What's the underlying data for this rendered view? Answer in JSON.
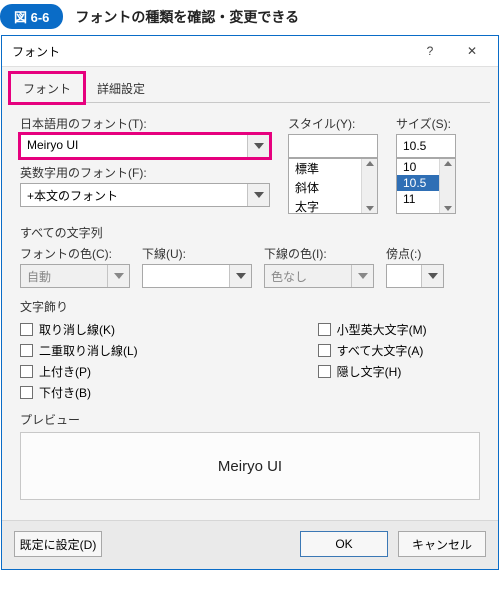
{
  "figure": {
    "badge": "図 6-6",
    "caption": "フォントの種類を確認・変更できる"
  },
  "dialog": {
    "title": "フォント",
    "tabs": {
      "font": "フォント",
      "advanced": "詳細設定"
    }
  },
  "labels": {
    "jpFont": "日本語用のフォント(T):",
    "latinFont": "英数字用のフォント(F):",
    "style": "スタイル(Y):",
    "size": "サイズ(S):",
    "allText": "すべての文字列",
    "fontColor": "フォントの色(C):",
    "underline": "下線(U):",
    "underlineColor": "下線の色(I):",
    "emphasis": "傍点(:)",
    "decor": "文字飾り",
    "preview": "プレビュー"
  },
  "values": {
    "jpFont": "Meiryo UI",
    "latinFont": "+本文のフォント",
    "styleSelected": "",
    "styleOptions": [
      "標準",
      "斜体",
      "太字"
    ],
    "sizeValue": "10.5",
    "sizeOptions": [
      "10",
      "10.5",
      "11"
    ],
    "sizeSelected": "10.5",
    "fontColor": "自動",
    "underline": "",
    "underlineColor": "色なし",
    "emphasis": "",
    "previewText": "Meiryo UI"
  },
  "checks": {
    "strike": "取り消し線(K)",
    "dstrike": "二重取り消し線(L)",
    "superscript": "上付き(P)",
    "subscript": "下付き(B)",
    "smallcaps": "小型英大文字(M)",
    "allcaps": "すべて大文字(A)",
    "hidden": "隠し文字(H)"
  },
  "buttons": {
    "setDefault": "既定に設定(D)",
    "ok": "OK",
    "cancel": "キャンセル"
  }
}
